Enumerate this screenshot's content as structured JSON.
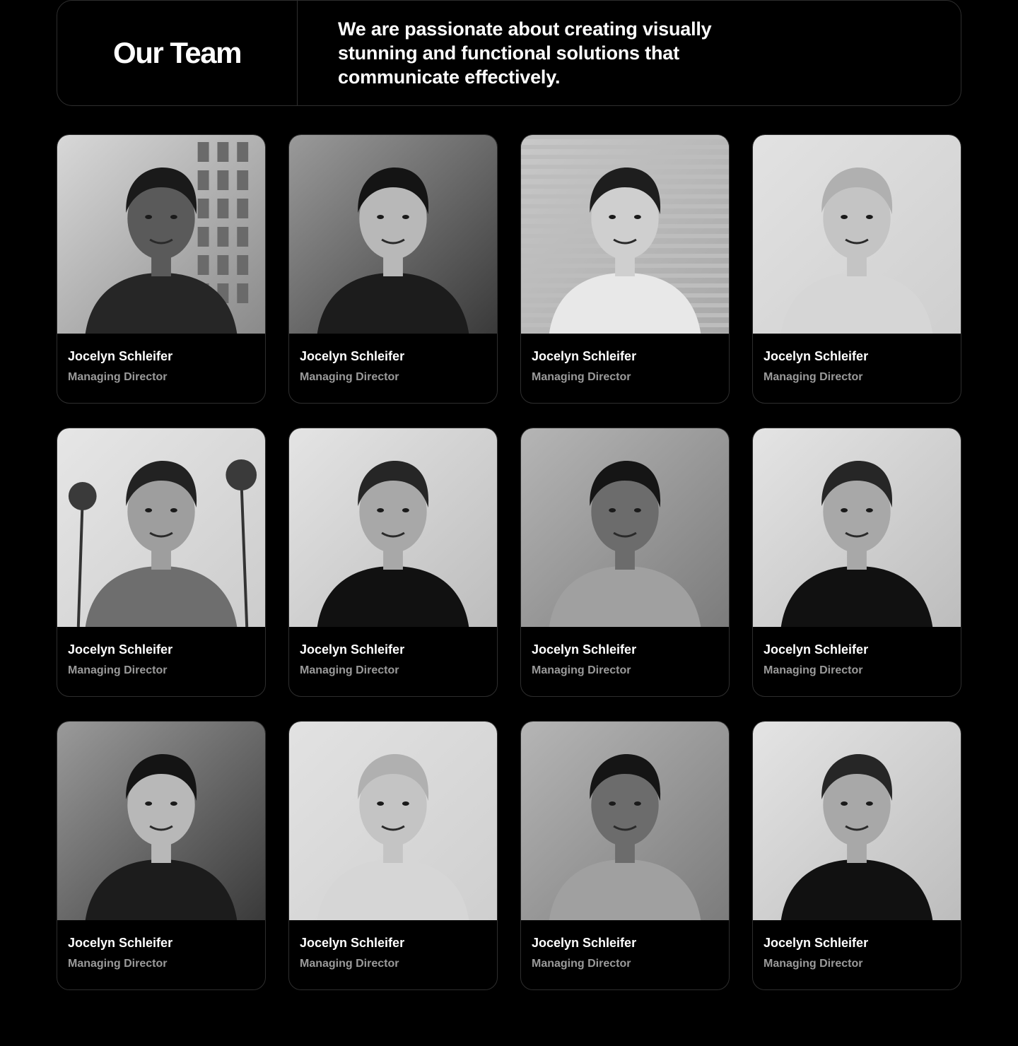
{
  "header": {
    "title": "Our Team",
    "description": "We are passionate about creating visually stunning and functional solutions that communicate effectively."
  },
  "team": [
    {
      "name": "Jocelyn Schleifer",
      "role": "Managing Director",
      "photo_icon": "portrait-photo",
      "tone": "light-window"
    },
    {
      "name": "Jocelyn Schleifer",
      "role": "Managing Director",
      "photo_icon": "portrait-photo",
      "tone": "mid-dark"
    },
    {
      "name": "Jocelyn Schleifer",
      "role": "Managing Director",
      "photo_icon": "portrait-photo",
      "tone": "light-stripes"
    },
    {
      "name": "Jocelyn Schleifer",
      "role": "Managing Director",
      "photo_icon": "portrait-photo",
      "tone": "light-plain"
    },
    {
      "name": "Jocelyn Schleifer",
      "role": "Managing Director",
      "photo_icon": "portrait-photo",
      "tone": "palms"
    },
    {
      "name": "Jocelyn Schleifer",
      "role": "Managing Director",
      "photo_icon": "portrait-photo",
      "tone": "light-dark-shirt"
    },
    {
      "name": "Jocelyn Schleifer",
      "role": "Managing Director",
      "photo_icon": "portrait-photo",
      "tone": "mid-gray"
    },
    {
      "name": "Jocelyn Schleifer",
      "role": "Managing Director",
      "photo_icon": "portrait-photo",
      "tone": "light-dark-shirt"
    },
    {
      "name": "Jocelyn Schleifer",
      "role": "Managing Director",
      "photo_icon": "portrait-photo",
      "tone": "mid-dark"
    },
    {
      "name": "Jocelyn Schleifer",
      "role": "Managing Director",
      "photo_icon": "portrait-photo",
      "tone": "light-plain"
    },
    {
      "name": "Jocelyn Schleifer",
      "role": "Managing Director",
      "photo_icon": "portrait-photo",
      "tone": "mid-gray"
    },
    {
      "name": "Jocelyn Schleifer",
      "role": "Managing Director",
      "photo_icon": "portrait-photo",
      "tone": "light-dark-shirt"
    }
  ],
  "colors": {
    "background": "#000000",
    "border": "#2e2e2e",
    "text_primary": "#ffffff",
    "text_secondary": "#9a9a9a"
  }
}
